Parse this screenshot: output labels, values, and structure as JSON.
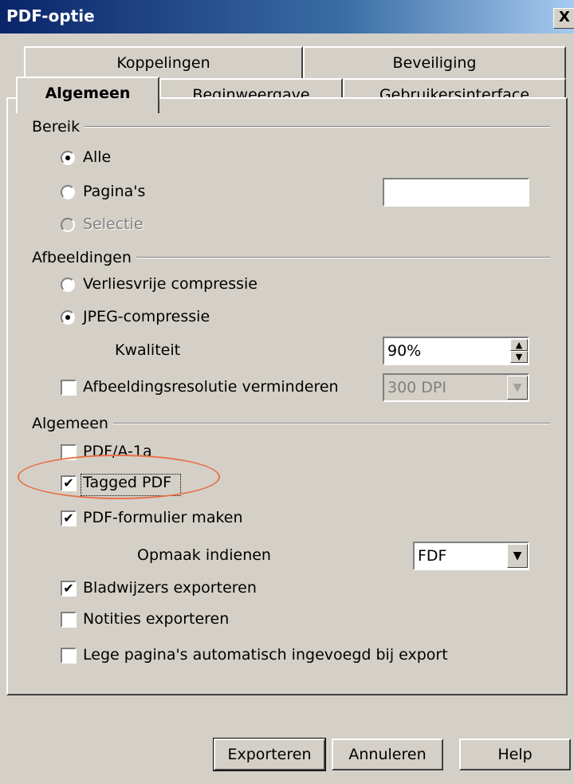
{
  "window": {
    "title": "PDF-optie",
    "close_label": "X"
  },
  "tabs": {
    "row_back": [
      "Koppelingen",
      "Beveiliging"
    ],
    "row_front": [
      "Algemeen",
      "Beginweergave",
      "Gebruikersinterface"
    ],
    "active": "Algemeen"
  },
  "bereik": {
    "label": "Bereik",
    "all_label": "Alle",
    "pages_label": "Pagina's",
    "pages_value": "",
    "selection_label": "Selectie"
  },
  "afbeeldingen": {
    "label": "Afbeeldingen",
    "lossless_label": "Verliesvrije compressie",
    "jpeg_label": "JPEG-compressie",
    "quality_label": "Kwaliteit",
    "quality_value": "90%",
    "reduce_label": "Afbeeldingsresolutie verminderen",
    "resolution_value": "300 DPI"
  },
  "algemeen": {
    "label": "Algemeen",
    "pdfa_label": "PDF/A-1a",
    "tagged_label": "Tagged PDF",
    "form_label": "PDF-formulier maken",
    "submit_label": "Opmaak indienen",
    "submit_value": "FDF",
    "bookmarks_label": "Bladwijzers exporteren",
    "notes_label": "Notities exporteren",
    "empty_pages_label": "Lege pagina's automatisch ingevoegd bij export"
  },
  "states": {
    "range": "all",
    "compression": "jpeg",
    "reduce_resolution": false,
    "pdfa": false,
    "tagged_pdf": true,
    "create_form": true,
    "export_bookmarks": true,
    "export_notes": false,
    "empty_pages": false
  },
  "buttons": {
    "export": "Exporteren",
    "cancel": "Annuleren",
    "help": "Help"
  },
  "annotation": {
    "color": "#e8714a"
  }
}
